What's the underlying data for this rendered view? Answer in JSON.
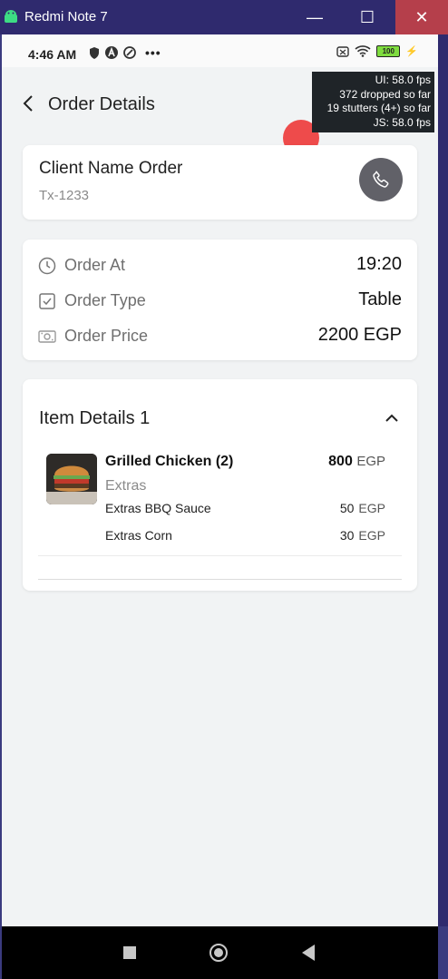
{
  "window": {
    "title": "Redmi Note 7",
    "minimize": "—",
    "maximize": "☐",
    "close": "✕"
  },
  "status_bar": {
    "time": "4:46 AM",
    "more": "•••",
    "battery": "100",
    "charging": "⚡"
  },
  "header": {
    "title": "Order Details"
  },
  "perf_overlay": {
    "ui": "UI: 58.0 fps",
    "dropped": "372 dropped so far",
    "stutters": "19 stutters (4+) so far",
    "js": "JS: 58.0 fps"
  },
  "client": {
    "name": "Client Name Order",
    "tx": "Tx-1233"
  },
  "order": {
    "at_label": "Order At",
    "at_value": "19:20",
    "type_label": "Order Type",
    "type_value": "Table",
    "price_label": "Order Price",
    "price_value": "2200 EGP"
  },
  "items": {
    "header": "Item Details 1",
    "item": {
      "name": "Grilled Chicken (2)",
      "price": "800",
      "currency": "EGP",
      "extras_label": "Extras"
    },
    "extras": [
      {
        "name": "Extras BBQ Sauce",
        "price": "50",
        "currency": "EGP"
      },
      {
        "name": "Extras Corn",
        "price": "30",
        "currency": "EGP"
      }
    ]
  }
}
